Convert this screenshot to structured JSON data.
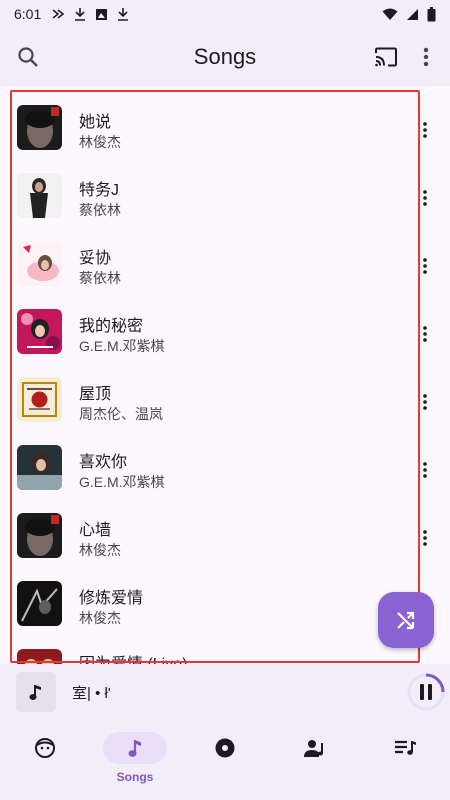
{
  "status_bar": {
    "time": "6:01"
  },
  "header": {
    "title": "Songs"
  },
  "songs": [
    {
      "title": "她说",
      "artist": "林俊杰"
    },
    {
      "title": "特务J",
      "artist": "蔡依林"
    },
    {
      "title": "妥协",
      "artist": "蔡依林"
    },
    {
      "title": "我的秘密",
      "artist": "G.E.M.邓紫棋"
    },
    {
      "title": "屋顶",
      "artist": "周杰伦、温岚"
    },
    {
      "title": "喜欢你",
      "artist": "G.E.M.邓紫棋"
    },
    {
      "title": "心墙",
      "artist": "林俊杰"
    },
    {
      "title": "修炼爱情",
      "artist": "林俊杰"
    },
    {
      "title": "因为爱情 (Live)",
      "artist": ""
    }
  ],
  "mini_player": {
    "title": "室| • ł'"
  },
  "bottom_nav": {
    "items": [
      {
        "icon": "face-icon",
        "label": ""
      },
      {
        "icon": "music-note-icon",
        "label": "Songs",
        "active": true
      },
      {
        "icon": "album-icon",
        "label": ""
      },
      {
        "icon": "artist-icon",
        "label": ""
      },
      {
        "icon": "playlist-icon",
        "label": ""
      }
    ]
  },
  "colors": {
    "accent": "#8a63d2",
    "surface": "#f3edf7",
    "background": "#fdf7ff",
    "highlight_border": "#e53935"
  }
}
